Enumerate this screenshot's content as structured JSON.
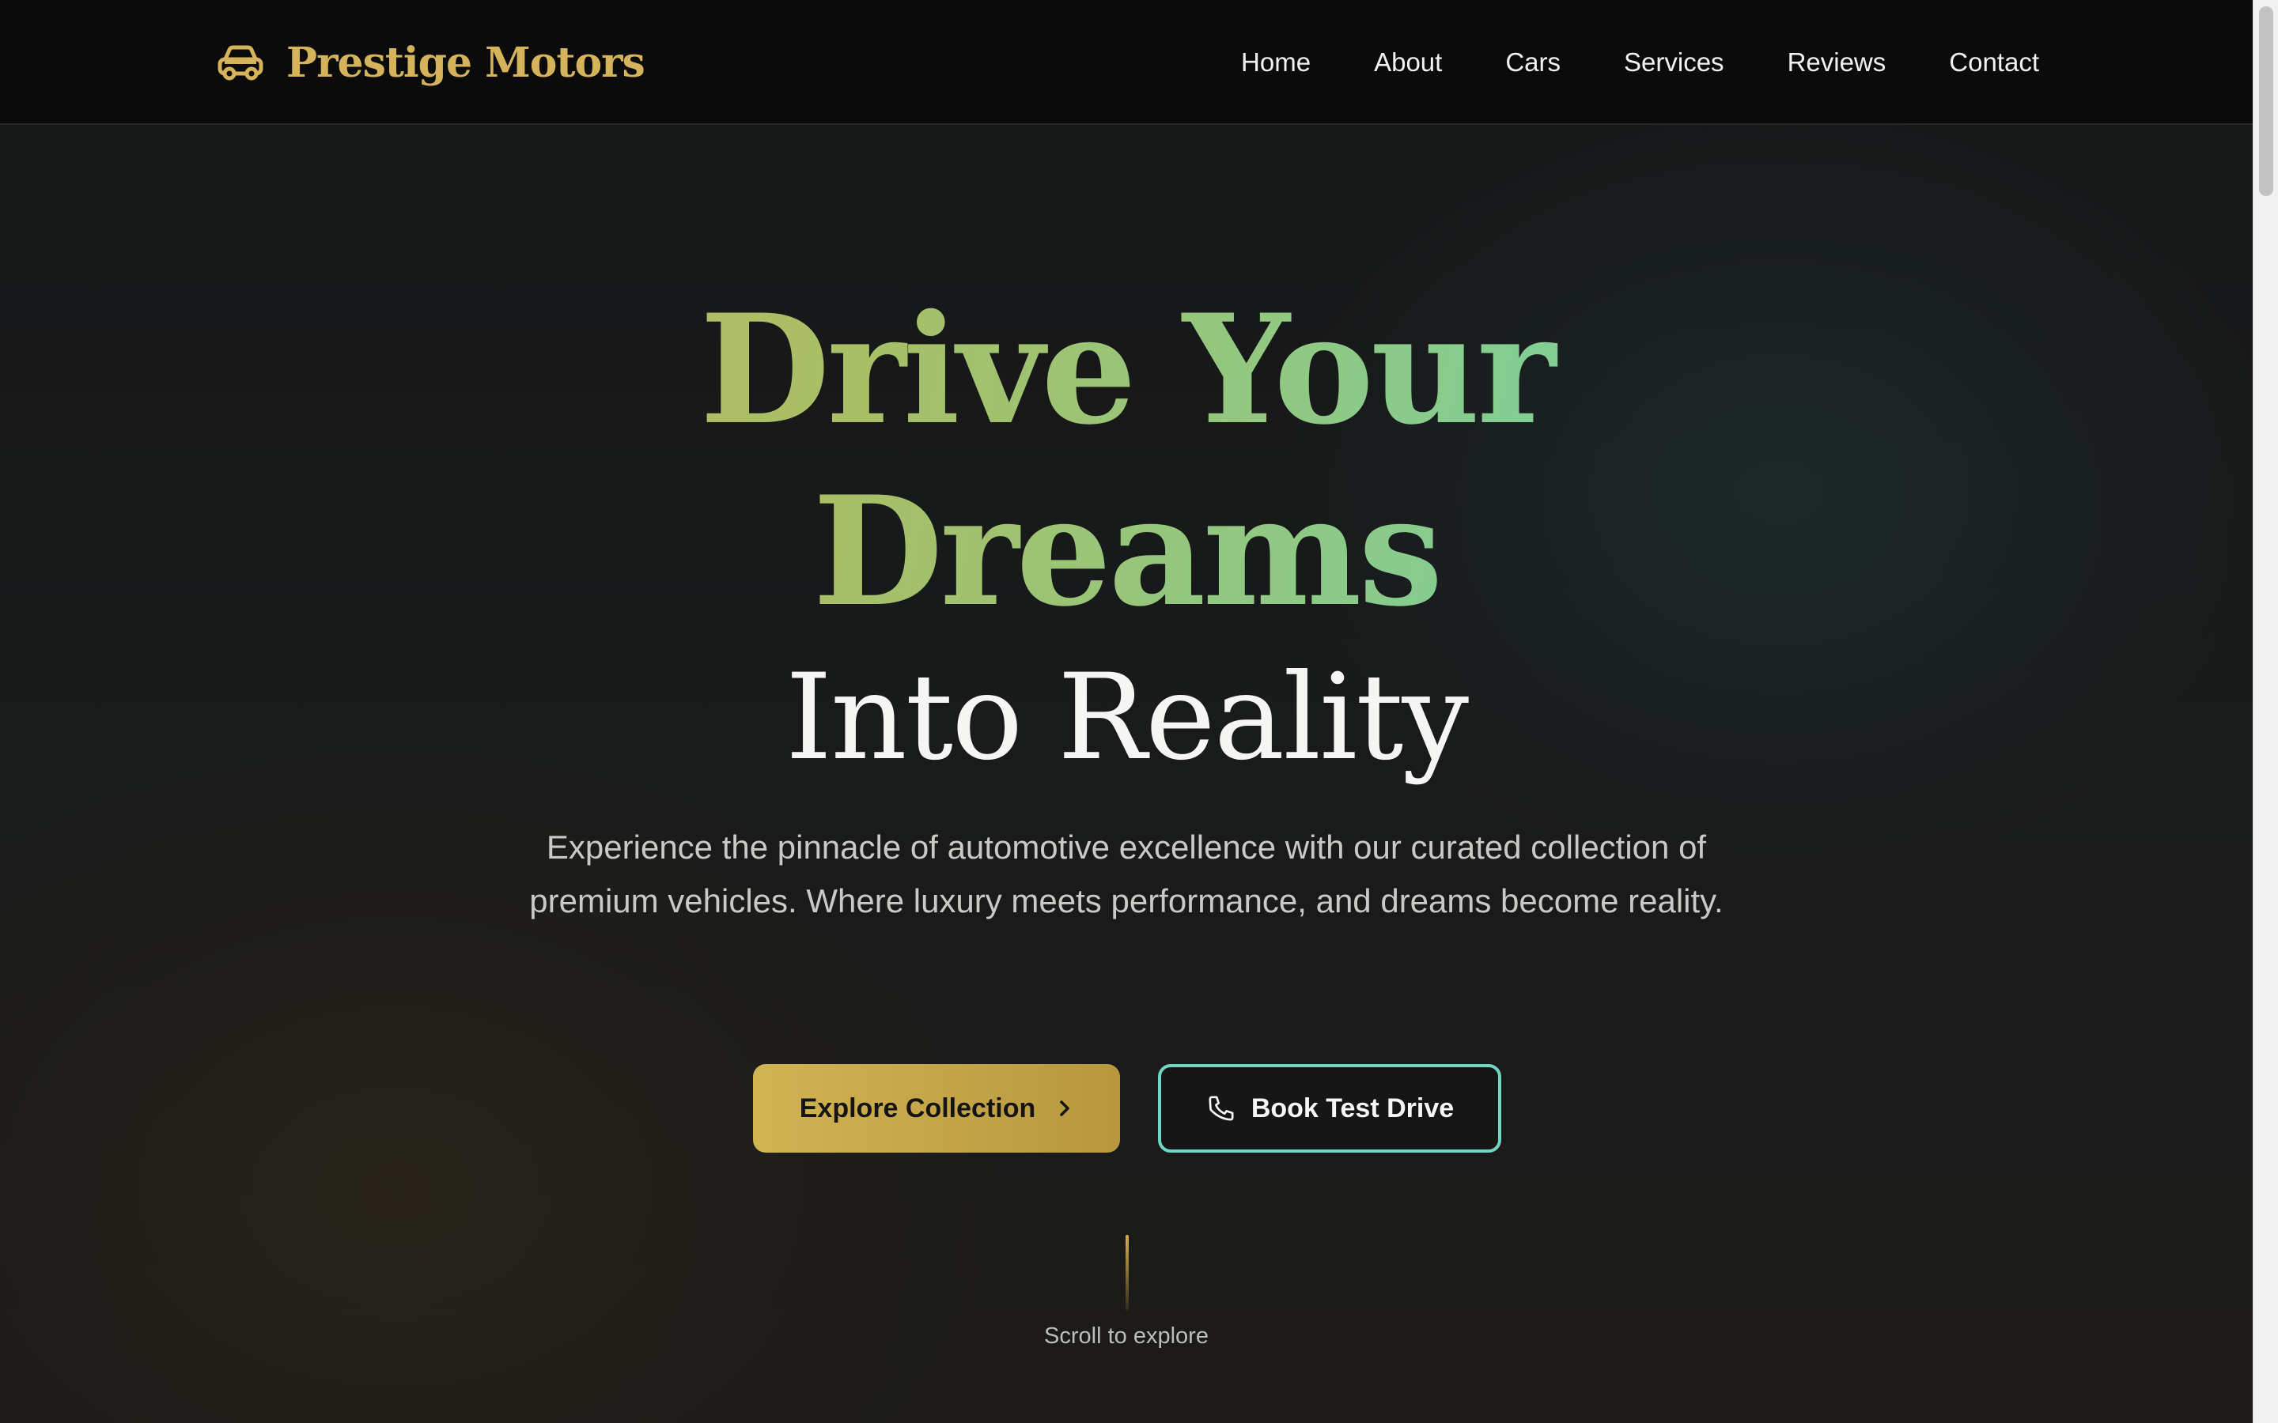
{
  "brand": {
    "name": "Prestige Motors",
    "icon": "car-icon",
    "color": "#d4b35a"
  },
  "nav": {
    "items": [
      {
        "label": "Home"
      },
      {
        "label": "About"
      },
      {
        "label": "Cars"
      },
      {
        "label": "Services"
      },
      {
        "label": "Reviews"
      },
      {
        "label": "Contact"
      }
    ]
  },
  "hero": {
    "headline_line1": "Drive Your",
    "headline_line2": "Dreams",
    "headline_line3": "Into Reality",
    "subtitle": "Experience the pinnacle of automotive excellence with our curated collection of premium vehicles. Where luxury meets performance, and dreams become reality.",
    "primary_button": {
      "label": "Explore Collection",
      "icon": "chevron-right-icon"
    },
    "secondary_button": {
      "label": "Book Test Drive",
      "icon": "phone-icon"
    },
    "scroll_hint": "Scroll to explore"
  },
  "colors": {
    "accent_gold": "#d1b452",
    "accent_teal": "#6fd6c4",
    "background": "#161718"
  }
}
